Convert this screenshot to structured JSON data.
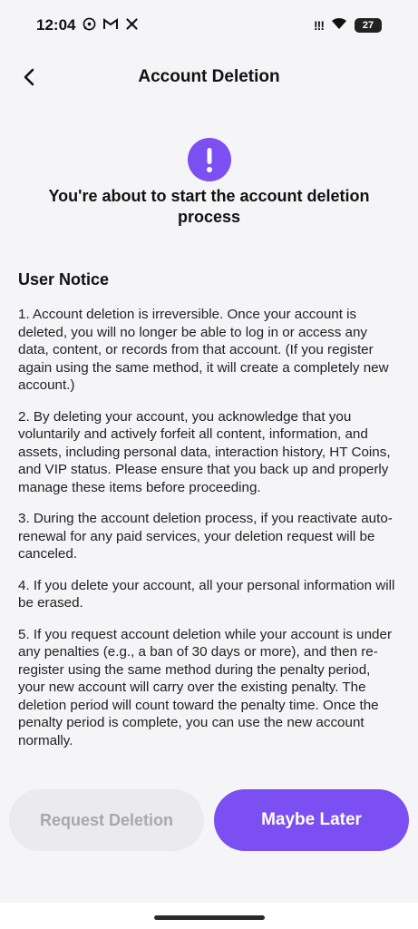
{
  "status_bar": {
    "time": "12:04",
    "icons": [
      "whatsapp-icon",
      "gmail-icon",
      "tools-icon"
    ],
    "signal_text": "!!!",
    "battery": "27"
  },
  "header": {
    "title": "Account Deletion",
    "back_icon": "chevron-left-icon"
  },
  "alert": {
    "icon": "exclamation-icon",
    "accent_color": "#7b4ff1",
    "headline": "You're about to start the account deletion process"
  },
  "notice": {
    "title": "User Notice",
    "paragraphs": [
      "1. Account deletion is irreversible. Once your account is deleted, you will no longer be able to log in or access any data, content, or records from that account. (If you register again using the same method, it will create a completely new account.)",
      "2. By deleting your account, you acknowledge that you voluntarily and actively forfeit all content, information, and assets, including personal data, interaction history, HT Coins, and VIP status. Please ensure that you back up and properly manage these items before proceeding.",
      "3. During the account deletion process, if you reactivate auto-renewal for any paid services, your deletion request will be canceled.",
      "4. If you delete your account, all your personal information will be erased.",
      "5. If you request account deletion while your account is under any penalties (e.g., a ban of 30 days or more), and then re-register using the same method during the penalty period, your new account will carry over the existing penalty. The deletion period will count toward the penalty time. Once the penalty period is complete, you can use the new account normally."
    ]
  },
  "actions": {
    "request_label": "Request Deletion",
    "later_label": "Maybe Later"
  }
}
